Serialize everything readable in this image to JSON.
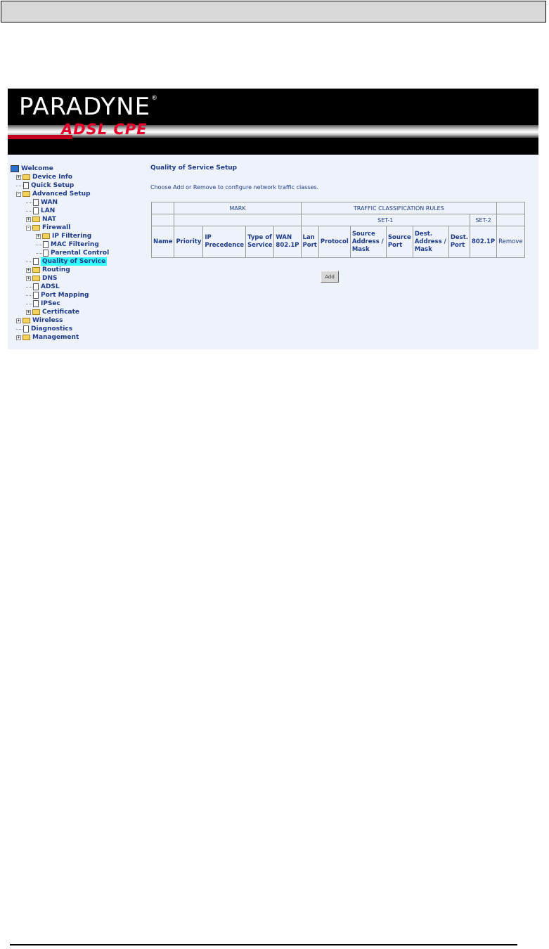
{
  "banner": {
    "brand": "PARADYNE",
    "reg_mark": "®",
    "product": "ADSL CPE"
  },
  "sidebar": {
    "items": [
      {
        "label": "Welcome",
        "icon": "computer-icon",
        "level": 0
      },
      {
        "label": "Device Info",
        "icon": "folder-icon",
        "level": 1,
        "expand": "+"
      },
      {
        "label": "Quick Setup",
        "icon": "page-icon",
        "level": 1
      },
      {
        "label": "Advanced Setup",
        "icon": "folder-open-icon",
        "level": 1,
        "expand": "-"
      },
      {
        "label": "WAN",
        "icon": "page-icon",
        "level": 2
      },
      {
        "label": "LAN",
        "icon": "page-icon",
        "level": 2
      },
      {
        "label": "NAT",
        "icon": "folder-icon",
        "level": 2,
        "expand": "+"
      },
      {
        "label": "Firewall",
        "icon": "folder-open-icon",
        "level": 2,
        "expand": "-"
      },
      {
        "label": "IP Filtering",
        "icon": "folder-icon",
        "level": 3,
        "expand": "+"
      },
      {
        "label": "MAC Filtering",
        "icon": "page-icon",
        "level": 3
      },
      {
        "label": "Parental Control",
        "icon": "page-icon",
        "level": 3
      },
      {
        "label": "Quality of Service",
        "icon": "page-icon",
        "level": 2,
        "active": true
      },
      {
        "label": "Routing",
        "icon": "folder-icon",
        "level": 2,
        "expand": "+"
      },
      {
        "label": "DNS",
        "icon": "folder-icon",
        "level": 2,
        "expand": "+"
      },
      {
        "label": "ADSL",
        "icon": "page-icon",
        "level": 2
      },
      {
        "label": "Port Mapping",
        "icon": "page-icon",
        "level": 2
      },
      {
        "label": "IPSec",
        "icon": "page-icon",
        "level": 2
      },
      {
        "label": "Certificate",
        "icon": "folder-icon",
        "level": 2,
        "expand": "+"
      },
      {
        "label": "Wireless",
        "icon": "folder-icon",
        "level": 1,
        "expand": "+"
      },
      {
        "label": "Diagnostics",
        "icon": "page-icon",
        "level": 1
      },
      {
        "label": "Management",
        "icon": "folder-icon",
        "level": 1,
        "expand": "+"
      }
    ]
  },
  "main": {
    "title": "Quality of Service Setup",
    "instruction": "Choose Add or Remove to configure network traffic classes.",
    "table": {
      "group_mark": "MARK",
      "group_rules": "TRAFFIC CLASSIFICATION RULES",
      "set1": "SET-1",
      "set2": "SET-2",
      "columns": [
        "Name",
        "Priority",
        "IP Precedence",
        "Type of Service",
        "WAN 802.1P",
        "Lan Port",
        "Protocol",
        "Source Address / Mask",
        "Source Port",
        "Dest. Address / Mask",
        "Dest. Port",
        "802.1P",
        "Remove"
      ]
    },
    "add_label": "Add"
  }
}
